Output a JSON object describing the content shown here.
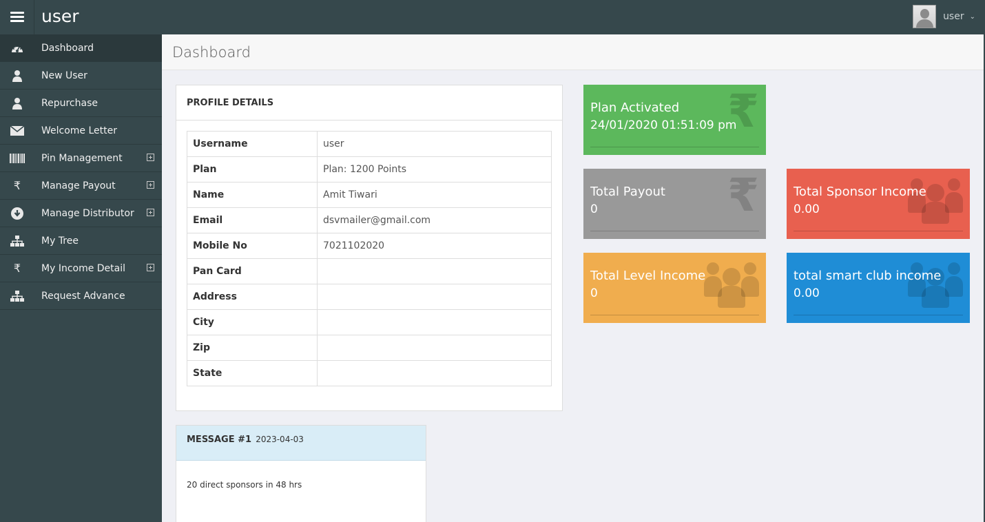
{
  "header": {
    "brand": "user",
    "user_name": "user",
    "caret": "⌄",
    "colors": {
      "topbar": "#36484c"
    }
  },
  "sidebar": {
    "items": [
      {
        "label": "Dashboard",
        "icon": "dashboard-icon",
        "expandable": false,
        "active": true
      },
      {
        "label": "New User",
        "icon": "user-icon",
        "expandable": false
      },
      {
        "label": "Repurchase",
        "icon": "user-icon",
        "expandable": false
      },
      {
        "label": "Welcome Letter",
        "icon": "envelope-icon",
        "expandable": false
      },
      {
        "label": "Pin Management",
        "icon": "barcode-icon",
        "expandable": true
      },
      {
        "label": "Manage Payout",
        "icon": "rupee-icon",
        "expandable": true
      },
      {
        "label": "Manage Distributor",
        "icon": "download-circle-icon",
        "expandable": true
      },
      {
        "label": "My Tree",
        "icon": "sitemap-icon",
        "expandable": false
      },
      {
        "label": "My Income Detail",
        "icon": "rupee-icon",
        "expandable": true
      },
      {
        "label": "Request Advance",
        "icon": "sitemap-icon",
        "expandable": false
      }
    ]
  },
  "page": {
    "title": "Dashboard"
  },
  "profile": {
    "title": "PROFILE DETAILS",
    "rows": [
      {
        "key": "Username",
        "value": "user"
      },
      {
        "key": "Plan",
        "value": "Plan: 1200 Points"
      },
      {
        "key": "Name",
        "value": "Amit Tiwari"
      },
      {
        "key": "Email",
        "value": "dsvmailer@gmail.com"
      },
      {
        "key": "Mobile No",
        "value": "7021102020"
      },
      {
        "key": "Pan Card",
        "value": ""
      },
      {
        "key": "Address",
        "value": ""
      },
      {
        "key": "City",
        "value": ""
      },
      {
        "key": "Zip",
        "value": ""
      },
      {
        "key": "State",
        "value": ""
      }
    ]
  },
  "message": {
    "title": "MESSAGE #1",
    "date": "2023-04-03",
    "body": "20 direct sponsors in 48 hrs"
  },
  "tiles": {
    "plan": {
      "title": "Plan Activated",
      "value": "24/01/2020 01:51:09 pm",
      "color": "#5cb85c",
      "icon": "rupee-icon"
    },
    "payout": {
      "title": "Total Payout",
      "value": "0",
      "color": "#999999",
      "icon": "rupee-icon"
    },
    "sponsor": {
      "title": "Total Sponsor Income",
      "value": "0.00",
      "color": "#e8604f",
      "icon": "users-icon"
    },
    "level": {
      "title": "Total Level Income",
      "value": "0",
      "color": "#f0ad4e",
      "icon": "users-icon"
    },
    "club": {
      "title": "total smart club income",
      "value": "0.00",
      "color": "#1f8dd6",
      "icon": "users-icon"
    }
  }
}
